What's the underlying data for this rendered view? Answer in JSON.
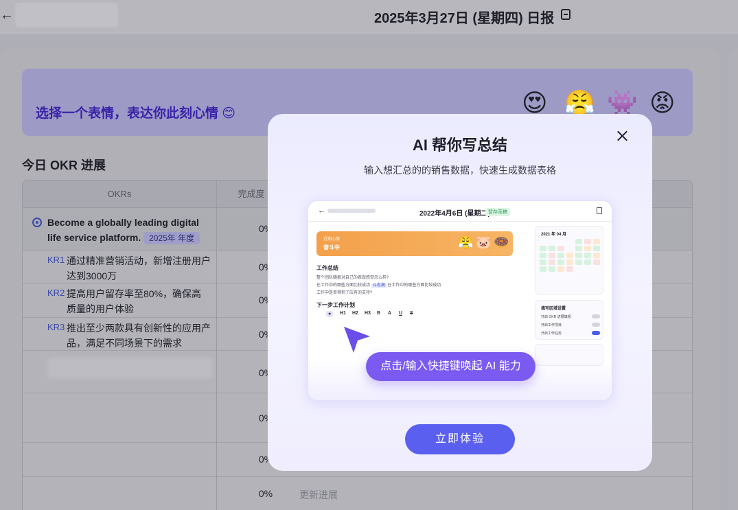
{
  "header": {
    "title": "2025年3月27日 (星期四) 日报"
  },
  "mood": {
    "prompt": "选择一个表情，表达你此刻心情 😊",
    "emojis": [
      "😍",
      "😤",
      "👾",
      "😡"
    ]
  },
  "okr": {
    "heading": "今日 OKR 进展",
    "columns": [
      "OKRs",
      "完成度"
    ],
    "objective": {
      "text": "Become a globally leading digital life service platform.",
      "badge": "2025年 年度",
      "progress": "0%"
    },
    "key_results": [
      {
        "label": "KR1",
        "text": "通过精准营销活动，新增注册用户达到3000万",
        "progress": "0%"
      },
      {
        "label": "KR2",
        "text": "提高用户留存率至80%，确保高质量的用户体验",
        "progress": "0%"
      },
      {
        "label": "KR3",
        "text": "推出至少两款具有创新性的应用产品，满足不同场景下的需求",
        "progress": "0%"
      }
    ],
    "extra_rows": [
      {
        "progress": "0%"
      },
      {
        "progress": "0%"
      },
      {
        "progress": "0%"
      },
      {
        "progress": "0%",
        "update": "更新进展"
      }
    ]
  },
  "modal": {
    "title": "AI 帮你写总结",
    "subtitle": "输入想汇总的的销售数据，快速生成数据表格",
    "ai_hint": "点击/输入快捷键唤起 AI 能力",
    "cta": "立即体验",
    "preview": {
      "title": "2022年4月6日 (星期二) 日报",
      "tag": "暂存草稿",
      "banner_small": "近期心情",
      "banner_big": "奋斗中",
      "section1": "工作总结",
      "lines": [
        "整个团队随着对自己的表现感觉怎么样?",
        "在工作中的哪些方面比较成功",
        "工作中是否得到了应有的支持?"
      ],
      "highlight": "斗志满",
      "line2_tail": "在工作中的哪些方面比较成功",
      "section2": "下一步工作计划",
      "tools": [
        "H1",
        "H2",
        "H3",
        "B",
        "A",
        "U",
        "S"
      ],
      "calendar_title": "2021 年 04 月",
      "settings_title": "填写区域设置",
      "settings": [
        "开启 OKR 进展填报",
        "开启工作项目",
        "开启工作任务"
      ]
    }
  }
}
